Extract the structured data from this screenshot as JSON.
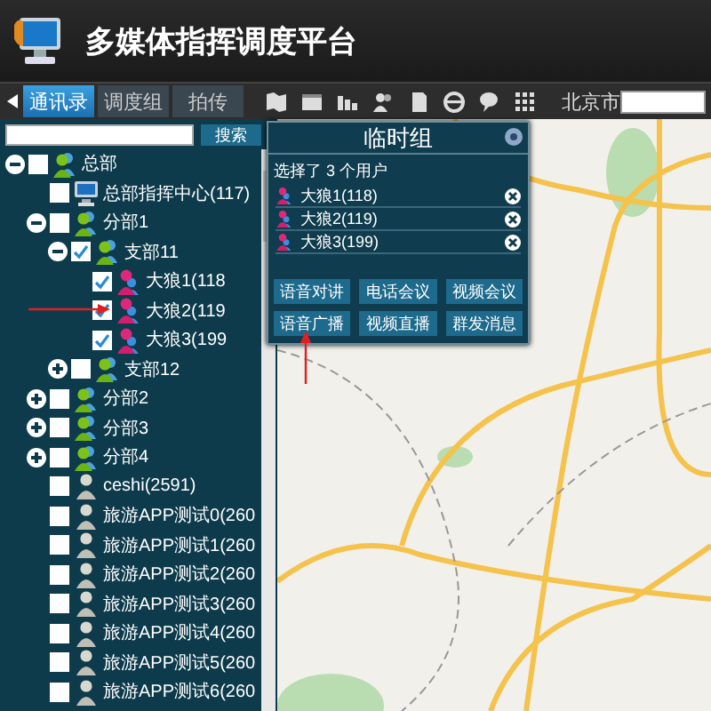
{
  "header": {
    "title": "多媒体指挥调度平台"
  },
  "tabs": [
    {
      "label": "通讯录",
      "selected": true
    },
    {
      "label": "调度组",
      "selected": false
    },
    {
      "label": "拍传",
      "selected": false
    }
  ],
  "toolbar": {
    "city": "北京市"
  },
  "search": {
    "button": "搜索"
  },
  "tree": [
    {
      "label": "总部",
      "kind": "group",
      "expanded": true,
      "checked": false,
      "children": [
        {
          "label": "总部指挥中心(117)",
          "kind": "center",
          "checked": false
        },
        {
          "label": "分部1",
          "kind": "group",
          "expanded": true,
          "checked": false,
          "children": [
            {
              "label": "支部11",
              "kind": "group",
              "expanded": true,
              "checked": true,
              "children": [
                {
                  "label": "大狼1(118",
                  "kind": "member",
                  "checked": true
                },
                {
                  "label": "大狼2(119",
                  "kind": "member",
                  "checked": true
                },
                {
                  "label": "大狼3(199",
                  "kind": "member",
                  "checked": true
                }
              ]
            },
            {
              "label": "支部12",
              "kind": "group",
              "expanded": false,
              "checked": false
            }
          ]
        },
        {
          "label": "分部2",
          "kind": "group",
          "expanded": false,
          "checked": false
        },
        {
          "label": "分部3",
          "kind": "group",
          "expanded": false,
          "checked": false
        },
        {
          "label": "分部4",
          "kind": "group",
          "expanded": false,
          "checked": false
        },
        {
          "label": "ceshi(2591)",
          "kind": "user",
          "checked": false
        },
        {
          "label": "旅游APP测试0(260",
          "kind": "user",
          "checked": false
        },
        {
          "label": "旅游APP测试1(260",
          "kind": "user",
          "checked": false
        },
        {
          "label": "旅游APP测试2(260",
          "kind": "user",
          "checked": false
        },
        {
          "label": "旅游APP测试3(260",
          "kind": "user",
          "checked": false
        },
        {
          "label": "旅游APP测试4(260",
          "kind": "user",
          "checked": false
        },
        {
          "label": "旅游APP测试5(260",
          "kind": "user",
          "checked": false
        },
        {
          "label": "旅游APP测试6(260",
          "kind": "user",
          "checked": false
        }
      ]
    }
  ],
  "popup": {
    "title": "临时组",
    "summary": "选择了 3 个用户",
    "members": [
      {
        "label": "大狼1(118)"
      },
      {
        "label": "大狼2(119)"
      },
      {
        "label": "大狼3(199)"
      }
    ],
    "buttons": [
      "语音对讲",
      "电话会议",
      "视频会议",
      "语音广播",
      "视频直播",
      "群发消息"
    ]
  }
}
